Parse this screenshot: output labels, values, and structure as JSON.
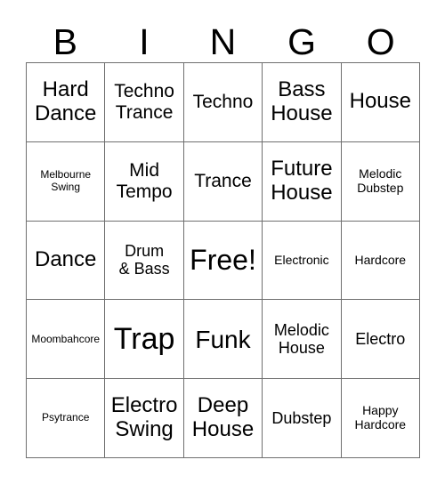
{
  "card": {
    "title": "BINGO",
    "header_letters": [
      "B",
      "I",
      "N",
      "G",
      "O"
    ],
    "free_space_label": "Free!",
    "colors": {
      "background": "#ffffff",
      "grid_line": "#6f6f6f",
      "text": "#000000"
    },
    "rows": [
      [
        {
          "label": "Hard\nDance",
          "size": "xl"
        },
        {
          "label": "Techno\nTrance",
          "size": "lg"
        },
        {
          "label": "Techno",
          "size": "lg"
        },
        {
          "label": "Bass\nHouse",
          "size": "xl"
        },
        {
          "label": "House",
          "size": "xl"
        }
      ],
      [
        {
          "label": "Melbourne\nSwing",
          "size": "xs"
        },
        {
          "label": "Mid\nTempo",
          "size": "lg"
        },
        {
          "label": "Trance",
          "size": "lg"
        },
        {
          "label": "Future\nHouse",
          "size": "xl"
        },
        {
          "label": "Melodic\nDubstep",
          "size": "sm"
        }
      ],
      [
        {
          "label": "Dance",
          "size": "xl"
        },
        {
          "label": "Drum\n& Bass",
          "size": "md"
        },
        {
          "label": "Free!",
          "size": "free"
        },
        {
          "label": "Electronic",
          "size": "sm"
        },
        {
          "label": "Hardcore",
          "size": "sm"
        }
      ],
      [
        {
          "label": "Moombahcore",
          "size": "xs"
        },
        {
          "label": "Trap",
          "size": "huge"
        },
        {
          "label": "Funk",
          "size": "xxl"
        },
        {
          "label": "Melodic\nHouse",
          "size": "md"
        },
        {
          "label": "Electro",
          "size": "md"
        }
      ],
      [
        {
          "label": "Psytrance",
          "size": "xs"
        },
        {
          "label": "Electro\nSwing",
          "size": "xl"
        },
        {
          "label": "Deep\nHouse",
          "size": "xl"
        },
        {
          "label": "Dubstep",
          "size": "md"
        },
        {
          "label": "Happy\nHardcore",
          "size": "sm"
        }
      ]
    ]
  }
}
